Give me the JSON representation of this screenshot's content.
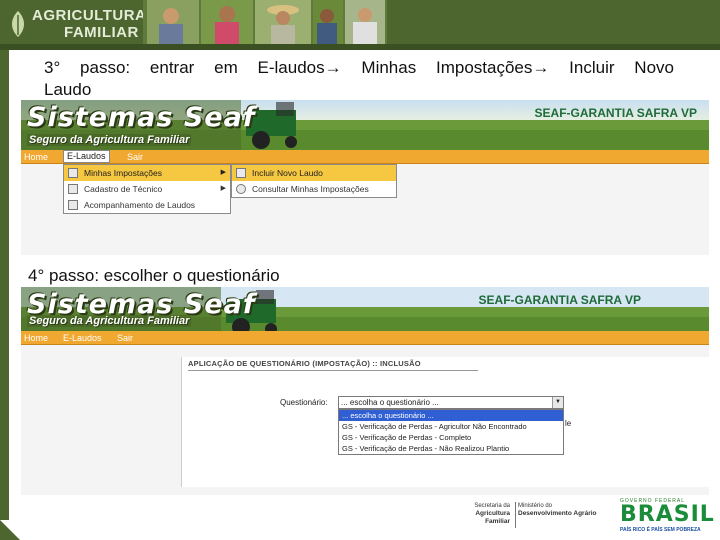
{
  "header": {
    "logo_line1": "AGRICULTURA",
    "logo_line2": "FAMILIAR"
  },
  "step3": {
    "text_line1": "3° passo: entrar em E-laudos→ Minhas Impostações→ Incluir Novo",
    "text_line2": "Laudo"
  },
  "step4": {
    "text": "4° passo: escolher o questionário"
  },
  "app": {
    "brand_title": "Sistemas Seaf",
    "brand_subtitle": "Seguro da Agricultura Familiar",
    "system_title": "SEAF-GARANTIA SAFRA VP",
    "menu": {
      "home": "Home",
      "elaudos": "E-Laudos",
      "sair": "Sair",
      "elaudos_lower": "E-Laudos"
    }
  },
  "shot1_menu": {
    "level1": [
      "Minhas Impostações",
      "Cadastro de Técnico",
      "Acompanhamento de Laudos"
    ],
    "level2": [
      "Incluir Novo Laudo",
      "Consultar Minhas Impostações"
    ]
  },
  "shot2_form": {
    "header": "APLICAÇÃO DE QUESTIONÁRIO (IMPOSTAÇÃO) :: INCLUSÃO",
    "label": "Questionário:",
    "selected": "... escolha o questionário ...",
    "options": [
      "... escolha o questionário ...",
      "GS - Verificação de Perdas - Agricultor Não Encontrado",
      "GS - Verificação de Perdas - Completo",
      "GS - Verificação de Perdas - Não Realizou Plantio"
    ],
    "partial_text": "le"
  },
  "footer": {
    "sec_line1": "Secretaria da",
    "sec_line2": "Agricultura Familiar",
    "min_line1": "Ministério do",
    "min_line2": "Desenvolvimento Agrário",
    "gov_label": "GOVERNO FEDERAL",
    "brasil": "BRASIL",
    "tagline": "PAÍS RICO É PAÍS SEM POBREZA"
  },
  "colors": {
    "header_green": "#4d6630",
    "menu_orange": "#f0a830",
    "highlight_yellow": "#f6c740",
    "selection_blue": "#2f5fd3",
    "system_title_green": "#1f6b3a"
  }
}
